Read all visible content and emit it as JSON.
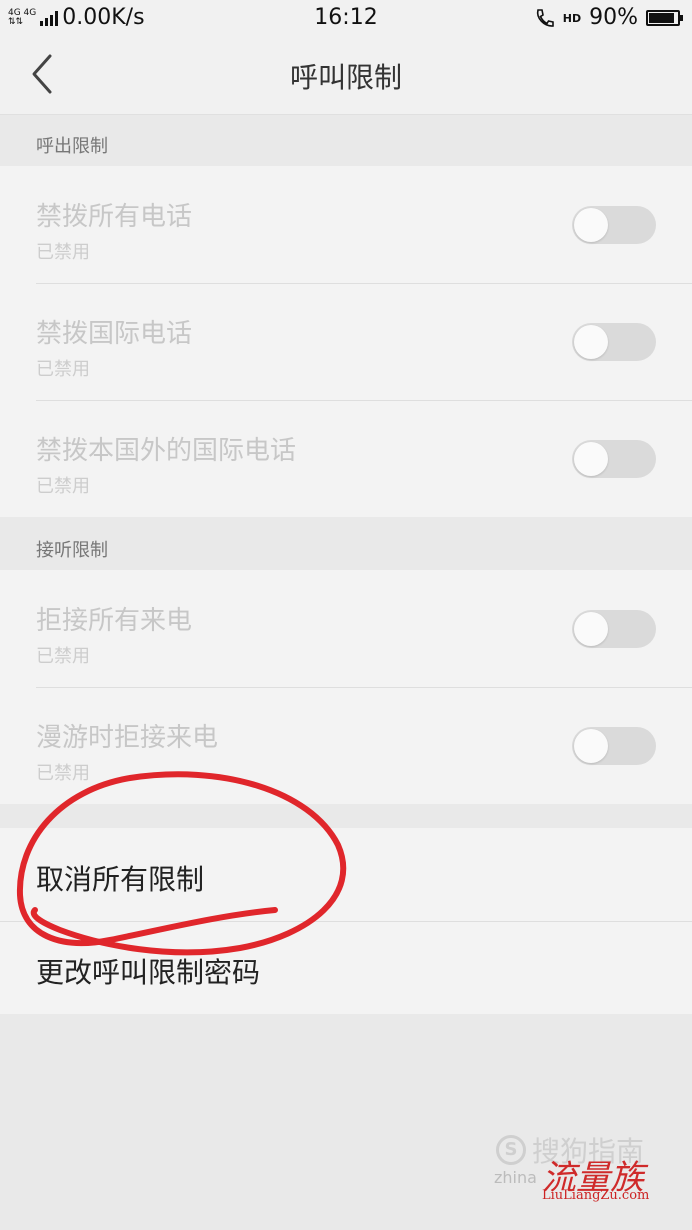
{
  "status_bar": {
    "network_label": "4G 4G",
    "speed": "0.00K/s",
    "time": "16:12",
    "hd_label": "HD",
    "battery_text": "90%",
    "battery_level": 0.9
  },
  "header": {
    "title": "呼叫限制",
    "back_icon": "chevron-left-icon"
  },
  "outgoing": {
    "section_title": "呼出限制",
    "items": [
      {
        "label": "禁拨所有电话",
        "status": "已禁用",
        "enabled": false
      },
      {
        "label": "禁拨国际电话",
        "status": "已禁用",
        "enabled": false
      },
      {
        "label": "禁拨本国外的国际电话",
        "status": "已禁用",
        "enabled": false
      }
    ]
  },
  "incoming": {
    "section_title": "接听限制",
    "items": [
      {
        "label": "拒接所有来电",
        "status": "已禁用",
        "enabled": false
      },
      {
        "label": "漫游时拒接来电",
        "status": "已禁用",
        "enabled": false
      }
    ]
  },
  "actions": {
    "items": [
      {
        "label": "取消所有限制"
      },
      {
        "label": "更改呼叫限制密码"
      }
    ]
  },
  "annotation": {
    "color": "#e0262b"
  },
  "watermark": {
    "sougou": "搜狗指南",
    "zhina": "zhina",
    "brand": "流量族",
    "domain": "LiuLiangZu.com"
  },
  "colors": {
    "background": "#e9e9e9",
    "disabled_text": "#c7c7c7",
    "toggle_off": "#dadada"
  }
}
